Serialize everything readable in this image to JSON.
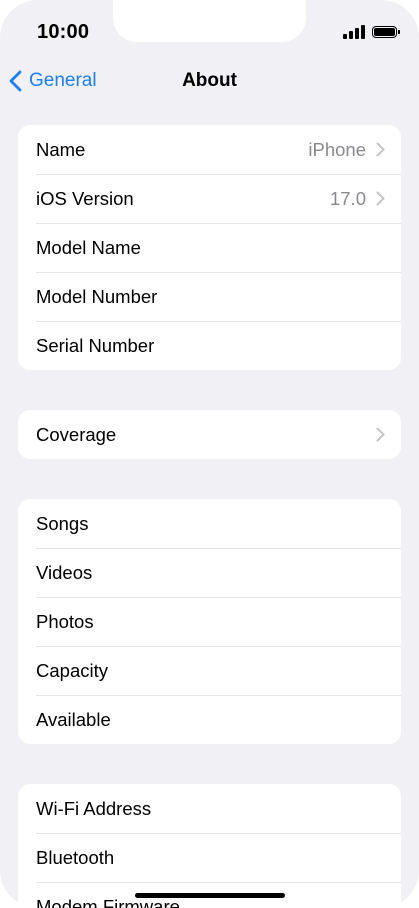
{
  "status": {
    "time": "10:00"
  },
  "nav": {
    "back_label": "General",
    "title": "About"
  },
  "group1": [
    {
      "label": "Name",
      "value": "iPhone",
      "chevron": true
    },
    {
      "label": "iOS Version",
      "value": "17.0",
      "chevron": true
    },
    {
      "label": "Model Name",
      "value": "",
      "chevron": false
    },
    {
      "label": "Model Number",
      "value": "",
      "chevron": false
    },
    {
      "label": "Serial Number",
      "value": "",
      "chevron": false
    }
  ],
  "group2": [
    {
      "label": "Coverage",
      "value": "",
      "chevron": true
    }
  ],
  "group3": [
    {
      "label": "Songs"
    },
    {
      "label": "Videos"
    },
    {
      "label": "Photos"
    },
    {
      "label": "Capacity"
    },
    {
      "label": "Available"
    }
  ],
  "group4": [
    {
      "label": "Wi-Fi Address"
    },
    {
      "label": "Bluetooth"
    },
    {
      "label": "Modem Firmware"
    }
  ],
  "colors": {
    "accent": "#1d7ff2",
    "background": "#f0f0f5",
    "secondary_text": "#8a8a8e"
  },
  "icons": {
    "back": "chevron-left-icon",
    "row_disclosure": "chevron-right-icon"
  }
}
